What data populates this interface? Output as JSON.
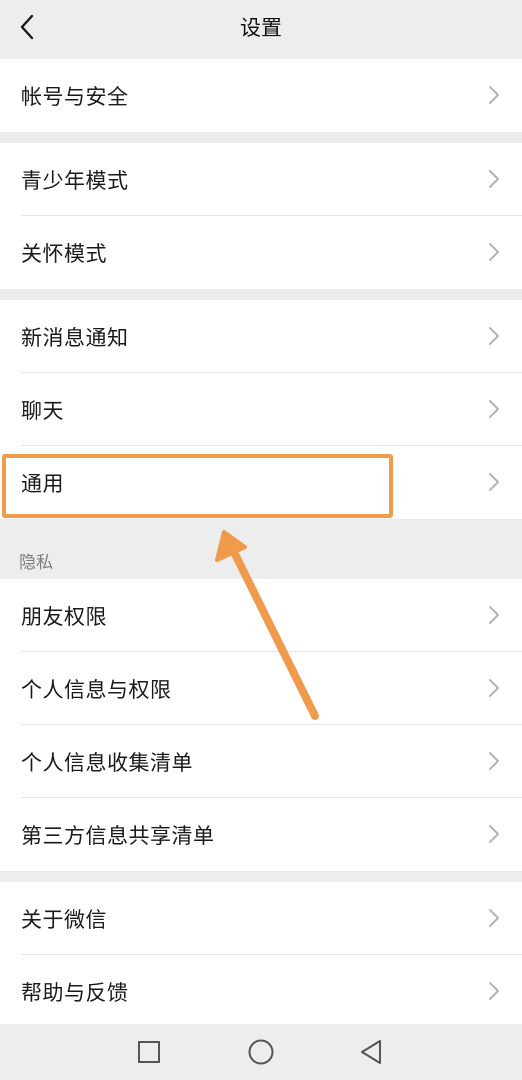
{
  "header": {
    "title": "设置",
    "back_icon": "chevron-left-icon"
  },
  "groups": [
    {
      "items": [
        {
          "label": "帐号与安全"
        }
      ]
    },
    {
      "items": [
        {
          "label": "青少年模式"
        },
        {
          "label": "关怀模式"
        }
      ]
    },
    {
      "items": [
        {
          "label": "新消息通知"
        },
        {
          "label": "聊天"
        },
        {
          "label": "通用"
        }
      ]
    },
    {
      "section_label": "隐私",
      "items": [
        {
          "label": "朋友权限"
        },
        {
          "label": "个人信息与权限"
        },
        {
          "label": "个人信息收集清单"
        },
        {
          "label": "第三方信息共享清单"
        }
      ]
    },
    {
      "items": [
        {
          "label": "关于微信"
        },
        {
          "label": "帮助与反馈"
        }
      ]
    }
  ],
  "annotation": {
    "highlighted_item": "通用",
    "color": "#f09a4c"
  },
  "navbar": {
    "icons": [
      "square-icon",
      "circle-icon",
      "triangle-back-icon"
    ]
  }
}
